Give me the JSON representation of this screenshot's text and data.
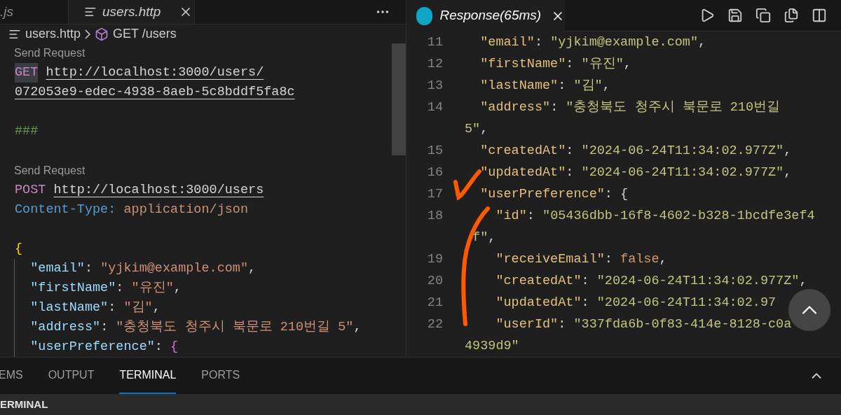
{
  "left_editor": {
    "tabs": [
      {
        "label": ".js",
        "selected": false
      },
      {
        "label": "users.http",
        "selected": true
      }
    ],
    "breadcrumb": {
      "file": "users.http",
      "symbol": "GET /users"
    },
    "lines": [
      {
        "kind": "codelens",
        "text": "Send Request"
      },
      {
        "kind": "code",
        "tokens": [
          {
            "kind": "method",
            "text": "GET",
            "highlighted": true
          },
          {
            "kind": "url",
            "text": "http://localhost:3000/users/"
          }
        ]
      },
      {
        "kind": "code",
        "tokens": [
          {
            "kind": "url",
            "text": "072053e9-edec-4938-8aeb-5c8bddf5fa8c"
          }
        ]
      },
      {
        "kind": "blank"
      },
      {
        "kind": "code",
        "tokens": [
          {
            "kind": "comment",
            "text": "###"
          }
        ]
      },
      {
        "kind": "blank"
      },
      {
        "kind": "codelens",
        "text": "Send Request"
      },
      {
        "kind": "code",
        "tokens": [
          {
            "kind": "method",
            "text": "POST",
            "highlighted": false
          },
          {
            "kind": "url",
            "text": "http://localhost:3000/users"
          }
        ]
      },
      {
        "kind": "code",
        "tokens": [
          {
            "kind": "header-name",
            "text": "Content-Type:"
          },
          {
            "kind": "header-value",
            "text": "application/json"
          }
        ]
      },
      {
        "kind": "blank"
      },
      {
        "kind": "code",
        "tokens": [
          {
            "kind": "brace",
            "text": "{"
          }
        ]
      },
      {
        "kind": "code",
        "guide": true,
        "tokens": [
          {
            "kind": "key",
            "text": "  \"email\""
          },
          {
            "kind": "punct",
            "text": ": "
          },
          {
            "kind": "string",
            "text": "\"yjkim@example.com\""
          },
          {
            "kind": "punct",
            "text": ","
          }
        ]
      },
      {
        "kind": "code",
        "guide": true,
        "tokens": [
          {
            "kind": "key",
            "text": "  \"firstName\""
          },
          {
            "kind": "punct",
            "text": ": "
          },
          {
            "kind": "string",
            "text": "\"유진\""
          },
          {
            "kind": "punct",
            "text": ","
          }
        ]
      },
      {
        "kind": "code",
        "guide": true,
        "tokens": [
          {
            "kind": "key",
            "text": "  \"lastName\""
          },
          {
            "kind": "punct",
            "text": ": "
          },
          {
            "kind": "string",
            "text": "\"김\""
          },
          {
            "kind": "punct",
            "text": ","
          }
        ]
      },
      {
        "kind": "code",
        "guide": true,
        "tokens": [
          {
            "kind": "key",
            "text": "  \"address\""
          },
          {
            "kind": "punct",
            "text": ": "
          },
          {
            "kind": "string",
            "text": "\"충청북도 청주시 북문로 210번길 5\""
          },
          {
            "kind": "punct",
            "text": ","
          }
        ]
      },
      {
        "kind": "code",
        "guide": true,
        "tokens": [
          {
            "kind": "key",
            "text": "  \"userPreference\""
          },
          {
            "kind": "punct",
            "text": ": "
          },
          {
            "kind": "brace2",
            "text": "{"
          }
        ]
      }
    ]
  },
  "right_editor": {
    "tab": {
      "label": "Response(65ms)"
    },
    "lines": [
      {
        "number": "11",
        "tokens": [
          {
            "kind": "prop",
            "text": "  \"email\""
          },
          {
            "kind": "punct",
            "text": ": "
          },
          {
            "kind": "str",
            "text": "\"yjkim@example.com\""
          },
          {
            "kind": "punct",
            "text": ","
          }
        ]
      },
      {
        "number": "12",
        "tokens": [
          {
            "kind": "prop",
            "text": "  \"firstName\""
          },
          {
            "kind": "punct",
            "text": ": "
          },
          {
            "kind": "str",
            "text": "\"유진\""
          },
          {
            "kind": "punct",
            "text": ","
          }
        ]
      },
      {
        "number": "13",
        "tokens": [
          {
            "kind": "prop",
            "text": "  \"lastName\""
          },
          {
            "kind": "punct",
            "text": ": "
          },
          {
            "kind": "str",
            "text": "\"김\""
          },
          {
            "kind": "punct",
            "text": ","
          }
        ]
      },
      {
        "number": "14",
        "tokens": [
          {
            "kind": "prop",
            "text": "  \"address\""
          },
          {
            "kind": "punct",
            "text": ": "
          },
          {
            "kind": "str",
            "text": "\"충청북도 청주시 북문로 210번길"
          }
        ]
      },
      {
        "tokens": [
          {
            "kind": "str",
            "text": "5\""
          },
          {
            "kind": "punct",
            "text": ","
          }
        ]
      },
      {
        "number": "15",
        "tokens": [
          {
            "kind": "prop",
            "text": "  \"createdAt\""
          },
          {
            "kind": "punct",
            "text": ": "
          },
          {
            "kind": "str",
            "text": "\"2024-06-24T11:34:02.977Z\""
          },
          {
            "kind": "punct",
            "text": ","
          }
        ]
      },
      {
        "number": "16",
        "tokens": [
          {
            "kind": "prop",
            "text": "  \"updatedAt\""
          },
          {
            "kind": "punct",
            "text": ": "
          },
          {
            "kind": "str",
            "text": "\"2024-06-24T11:34:02.977Z\""
          },
          {
            "kind": "punct",
            "text": ","
          }
        ]
      },
      {
        "number": "17",
        "tokens": [
          {
            "kind": "prop",
            "text": "  \"userPreference\""
          },
          {
            "kind": "punct",
            "text": ": {"
          }
        ]
      },
      {
        "number": "18",
        "tokens": [
          {
            "kind": "prop",
            "text": "    \"id\""
          },
          {
            "kind": "punct",
            "text": ": "
          },
          {
            "kind": "str",
            "text": "\"05436dbb-16f8-4602-b328-1bcdfe3ef4"
          }
        ]
      },
      {
        "tokens": [
          {
            "kind": "str",
            "text": " f\""
          },
          {
            "kind": "punct",
            "text": ","
          }
        ]
      },
      {
        "number": "19",
        "tokens": [
          {
            "kind": "prop",
            "text": "    \"receiveEmail\""
          },
          {
            "kind": "punct",
            "text": ": "
          },
          {
            "kind": "bool",
            "text": "false"
          },
          {
            "kind": "punct",
            "text": ","
          }
        ]
      },
      {
        "number": "20",
        "tokens": [
          {
            "kind": "prop",
            "text": "    \"createdAt\""
          },
          {
            "kind": "punct",
            "text": ": "
          },
          {
            "kind": "str",
            "text": "\"2024-06-24T11:34:02.977Z\""
          },
          {
            "kind": "punct",
            "text": ","
          }
        ]
      },
      {
        "number": "21",
        "tokens": [
          {
            "kind": "prop",
            "text": "    \"updatedAt\""
          },
          {
            "kind": "punct",
            "text": ": "
          },
          {
            "kind": "str",
            "text": "\"2024-06-24T11:34:02.97"
          }
        ]
      },
      {
        "number": "22",
        "tokens": [
          {
            "kind": "prop",
            "text": "    \"userId\""
          },
          {
            "kind": "punct",
            "text": ": "
          },
          {
            "kind": "str",
            "text": "\"337fda6b-0f83-414e-8128-c0a"
          }
        ]
      },
      {
        "tokens": [
          {
            "kind": "str",
            "text": "4939d9\""
          }
        ]
      }
    ]
  },
  "panel": {
    "tabs": [
      {
        "label": "EMS",
        "selected": false
      },
      {
        "label": "OUTPUT",
        "selected": false
      },
      {
        "label": "TERMINAL",
        "selected": true
      },
      {
        "label": "PORTS",
        "selected": false
      }
    ],
    "section_title": "ERMINAL"
  }
}
